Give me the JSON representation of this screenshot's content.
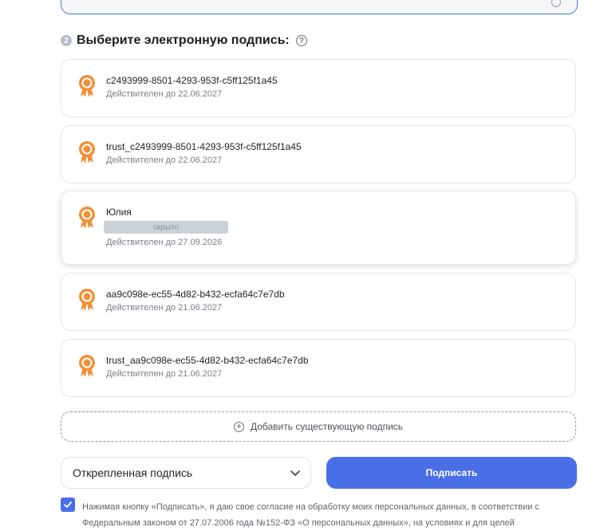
{
  "section": {
    "step": "2",
    "title": "Выберите электронную подпись:",
    "help": "?"
  },
  "certificates": [
    {
      "name": "c2493999-8501-4293-953f-c5ff125f1a45",
      "valid": "Действителен до 22.06.2027"
    },
    {
      "name": "trust_c2493999-8501-4293-953f-c5ff125f1a45",
      "valid": "Действителен до 22.06.2027"
    },
    {
      "name": "Юлия",
      "hidden_label": "скрыто",
      "valid": "Действителен до 27.09.2026",
      "selected": true
    },
    {
      "name": "aa9c098e-ec55-4d82-b432-ecfa64c7e7db",
      "valid": "Действителен до 21.06.2027"
    },
    {
      "name": "trust_aa9c098e-ec55-4d82-b432-ecfa64c7e7db",
      "valid": "Действителен до 21.06.2027"
    }
  ],
  "add_signature": {
    "label": "Добавить существующую подпись",
    "icon": "plus-circle-icon"
  },
  "signature_type": {
    "value": "Открепленная подпись",
    "icon": "chevron-down-icon"
  },
  "sign_button": {
    "label": "Подписать"
  },
  "consent": {
    "checked": true,
    "text": "Нажимая кнопку «Подписать», я даю свое согласие на обработку моих персональных данных, в соответствии с Федеральным законом от 27.07.2006 года №152-ФЗ «О персональных данных», на условиях и для целей"
  },
  "colors": {
    "accent": "#4a6ee6",
    "cert_icon": "#f0913a",
    "border": "#e4e6ea"
  }
}
